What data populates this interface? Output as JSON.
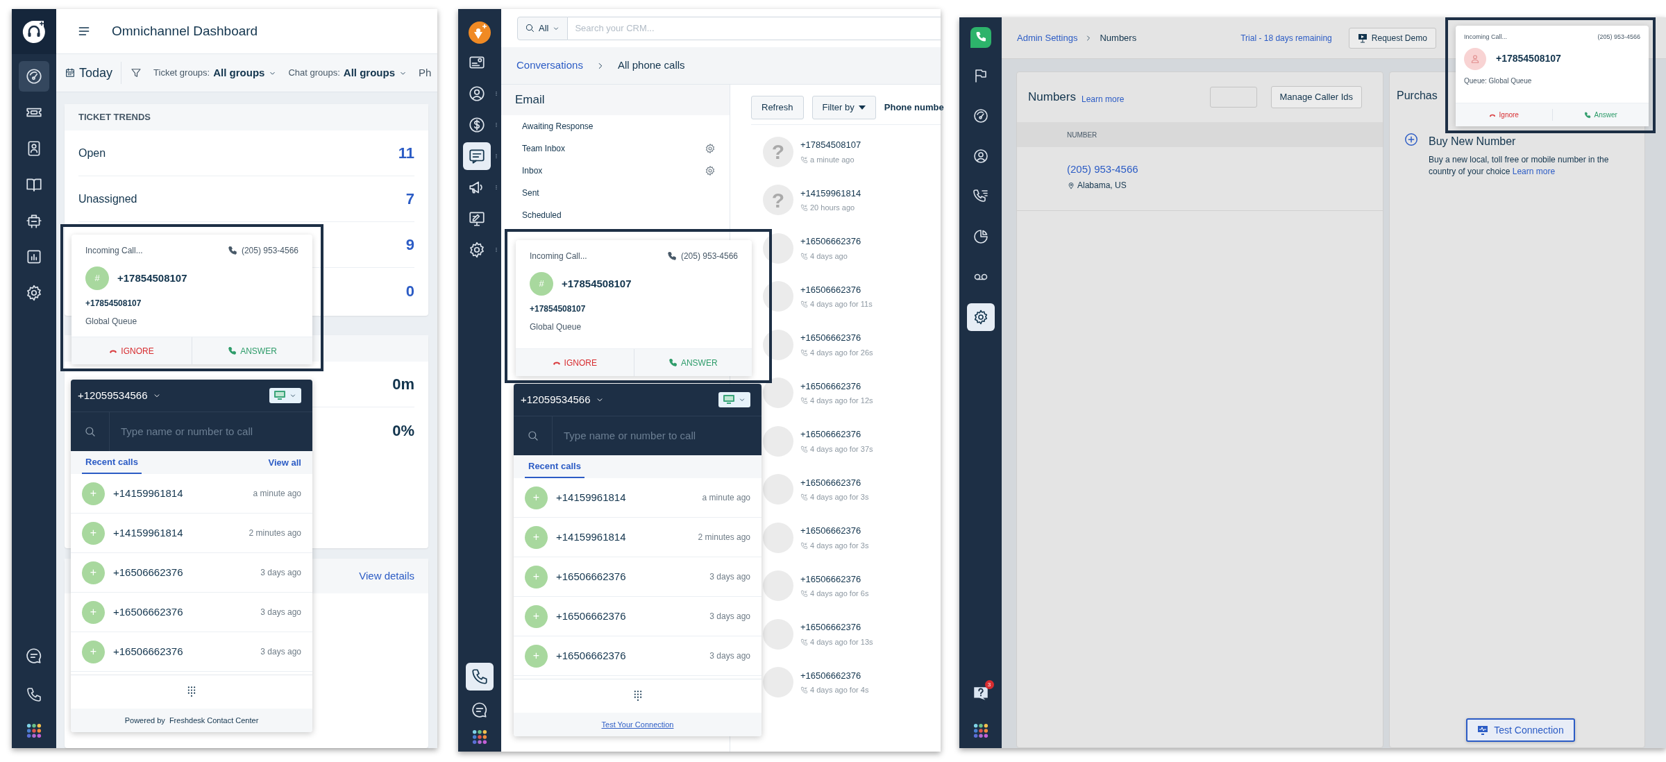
{
  "dashboard": {
    "sidebar": [
      {
        "selected": true
      },
      {
        "selected": false
      },
      {
        "selected": false
      },
      {
        "selected": false
      },
      {
        "selected": false
      },
      {
        "selected": false
      },
      {
        "selected": false
      }
    ],
    "title": "Omnichannel Dashboard",
    "date_filter": "Today",
    "group_filters": [
      {
        "label": "Ticket groups:",
        "value": "All groups"
      },
      {
        "label": "Chat groups:",
        "value": "All groups"
      }
    ],
    "cut_filter": "Ph",
    "ticket_trends": {
      "title": "TICKET TRENDS",
      "rows": [
        {
          "label": "Open",
          "value": "11"
        },
        {
          "label": "Unassigned",
          "value": "7"
        },
        {
          "value": "9"
        },
        {
          "value": "0"
        }
      ]
    },
    "metrics": [
      "0m",
      "0%"
    ],
    "details_link": "View details",
    "incoming_call": {
      "title": "Incoming Call...",
      "line": "(205) 953-4566",
      "avatar": "#",
      "caller": "+17854508107",
      "caller_detail": "+17854508107",
      "queue": "Global Queue",
      "ignore": "IGNORE",
      "answer": "ANSWER"
    },
    "dialer": {
      "number": "+12059534566",
      "placeholder": "Type name or number to call",
      "tabs": [
        {
          "label": "Recent calls",
          "selected": true
        }
      ],
      "view_all": "View all",
      "calls": [
        {
          "avatar": "+",
          "number": "+14159961814",
          "time": "a minute ago"
        },
        {
          "avatar": "+",
          "number": "+14159961814",
          "time": "2 minutes ago"
        },
        {
          "avatar": "+",
          "number": "+16506662376",
          "time": "3 days ago"
        },
        {
          "avatar": "+",
          "number": "+16506662376",
          "time": "3 days ago"
        },
        {
          "avatar": "+",
          "number": "+16506662376",
          "time": "3 days ago"
        }
      ],
      "footer": {
        "kind": "text",
        "text": "Powered by  Freshdesk Contact Center"
      }
    }
  },
  "crm": {
    "sidebar": [
      {
        "selected": false
      },
      {
        "selected": false
      },
      {
        "selected": false
      },
      {
        "selected": true
      },
      {
        "selected": false
      },
      {
        "selected": false
      },
      {
        "selected": false
      }
    ],
    "sidebar_bottom": [
      {
        "selected": true
      },
      {
        "selected": false
      }
    ],
    "search": {
      "scope": "All",
      "placeholder": "Search your CRM..."
    },
    "breadcrumb": {
      "parent": "Conversations",
      "current": "All phone calls"
    },
    "folder_title": "Email",
    "folders": [
      {
        "label": "Awaiting Response",
        "has_settings": false
      },
      {
        "label": "Team Inbox",
        "has_settings": true
      },
      {
        "label": "Inbox",
        "has_settings": true
      },
      {
        "label": "Sent",
        "has_settings": false
      },
      {
        "label": "Scheduled",
        "has_settings": false
      }
    ],
    "toolbar": {
      "refresh": "Refresh",
      "filter": "Filter by",
      "cut_label": "Phone numbe"
    },
    "calls": [
      {
        "avatar": "?",
        "number": "+17854508107",
        "time": "a minute ago"
      },
      {
        "avatar": "?",
        "number": "+14159961814",
        "time": "20 hours ago"
      },
      {
        "number": "+16506662376",
        "time": "4 days ago"
      },
      {
        "number": "+16506662376",
        "time": "4 days ago for 11s"
      },
      {
        "number": "+16506662376",
        "time": "4 days ago for 26s"
      },
      {
        "number": "+16506662376",
        "time": "4 days ago for 12s"
      },
      {
        "number": "+16506662376",
        "time": "4 days ago for 37s"
      },
      {
        "number": "+16506662376",
        "time": "4 days ago for 3s"
      },
      {
        "number": "+16506662376",
        "time": "4 days ago for 3s"
      },
      {
        "number": "+16506662376",
        "time": "4 days ago for 6s"
      },
      {
        "number": "+16506662376",
        "time": "4 days ago for 13s"
      },
      {
        "number": "+16506662376",
        "time": "4 days ago for 4s"
      }
    ],
    "incoming_call": {
      "title": "Incoming Call...",
      "line": "(205) 953-4566",
      "avatar": "#",
      "caller": "+17854508107",
      "caller_detail": "+17854508107",
      "queue": "Global Queue",
      "ignore": "IGNORE",
      "answer": "ANSWER"
    },
    "dialer": {
      "number": "+12059534566",
      "placeholder": "Type name or number to call",
      "tabs": [
        {
          "label": "Recent calls",
          "selected": true
        }
      ],
      "calls": [
        {
          "avatar": "+",
          "number": "+14159961814",
          "time": "a minute ago"
        },
        {
          "avatar": "+",
          "number": "+14159961814",
          "time": "2 minutes ago"
        },
        {
          "avatar": "+",
          "number": "+16506662376",
          "time": "3 days ago"
        },
        {
          "avatar": "+",
          "number": "+16506662376",
          "time": "3 days ago"
        },
        {
          "avatar": "+",
          "number": "+16506662376",
          "time": "3 days ago"
        }
      ],
      "footer": {
        "kind": "link",
        "text": "Test Your Connection"
      }
    }
  },
  "admin": {
    "sidebar": [
      {
        "selected": false
      },
      {
        "selected": false
      },
      {
        "selected": false
      },
      {
        "selected": false
      },
      {
        "selected": false
      },
      {
        "selected": false
      },
      {
        "selected": true
      }
    ],
    "breadcrumb": {
      "parent": "Admin Settings",
      "current": "Numbers"
    },
    "trial": "Trial - 18 days remaining",
    "request_demo": "Request Demo",
    "numbers": {
      "title": "Numbers",
      "learn_more": "Learn more",
      "manage": "Manage Caller Ids",
      "column": "NUMBER",
      "rows": [
        {
          "number": "(205) 953-4566",
          "location": "Alabama, US"
        }
      ]
    },
    "purchase": {
      "title": "Purchas",
      "option_title": "Buy New Number",
      "option_text": "Buy a new local, toll free or mobile number in the country of your choice",
      "option_link": "Learn more"
    },
    "help_badge": "3",
    "test_connection": "Test Connection",
    "incoming_call": {
      "title": "Incoming Call...",
      "line": "(205) 953-4566",
      "caller": "+17854508107",
      "queue": "Queue: Global Queue",
      "ignore": "Ignore",
      "answer": "Answer"
    }
  }
}
